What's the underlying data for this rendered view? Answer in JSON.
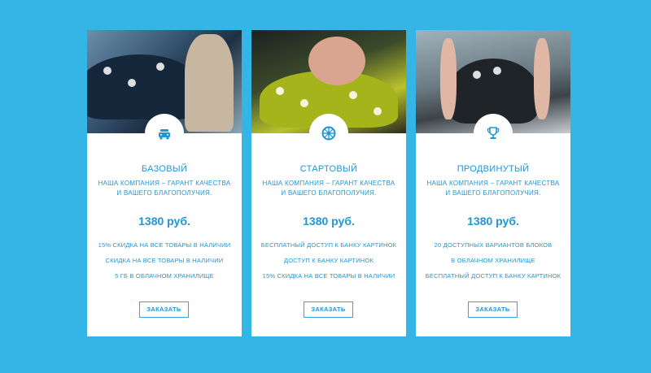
{
  "colors": {
    "background": "#35b5e6",
    "accent": "#2196d3",
    "card": "#ffffff"
  },
  "plans": [
    {
      "title": "БАЗОВЫЙ",
      "icon": "car-wash-icon",
      "description": "НАША КОМПАНИЯ – ГАРАНТ КАЧЕСТВА И ВАШЕГО БЛАГОПОЛУЧИЯ.",
      "price": "1380 руб.",
      "features": [
        "15% СКИДКА НА ВСЕ ТОВАРЫ В НАЛИЧИИ",
        "СКИДКА НА ВСЕ ТОВАРЫ В НАЛИЧИИ",
        "5 ГБ В ОБЛАЧНОМ ХРАНИЛИЩЕ"
      ],
      "button": "ЗАКАЗАТЬ"
    },
    {
      "title": "СТАРТОВЫЙ",
      "icon": "wheel-icon",
      "description": "НАША КОМПАНИЯ – ГАРАНТ КАЧЕСТВА И ВАШЕГО БЛАГОПОЛУЧИЯ.",
      "price": "1380 руб.",
      "features": [
        "БЕСПЛАТНЫЙ ДОСТУП К БАНКУ КАРТИНОК",
        "ДОСТУП К БАНКУ КАРТИНОК",
        "15% СКИДКА НА ВСЕ ТОВАРЫ В НАЛИЧИИ"
      ],
      "button": "ЗАКАЗАТЬ"
    },
    {
      "title": "ПРОДВИНУТЫЙ",
      "icon": "trophy-icon",
      "description": "НАША КОМПАНИЯ – ГАРАНТ КАЧЕСТВА И ВАШЕГО БЛАГОПОЛУЧИЯ.",
      "price": "1380 руб.",
      "features": [
        "20 ДОСТУПНЫХ ВАРИАНТОВ БЛОКОВ",
        "В ОБЛАЧНОМ ХРАНИЛИЩЕ",
        "БЕСПЛАТНЫЙ ДОСТУП К БАНКУ КАРТИНОК"
      ],
      "button": "ЗАКАЗАТЬ"
    }
  ]
}
